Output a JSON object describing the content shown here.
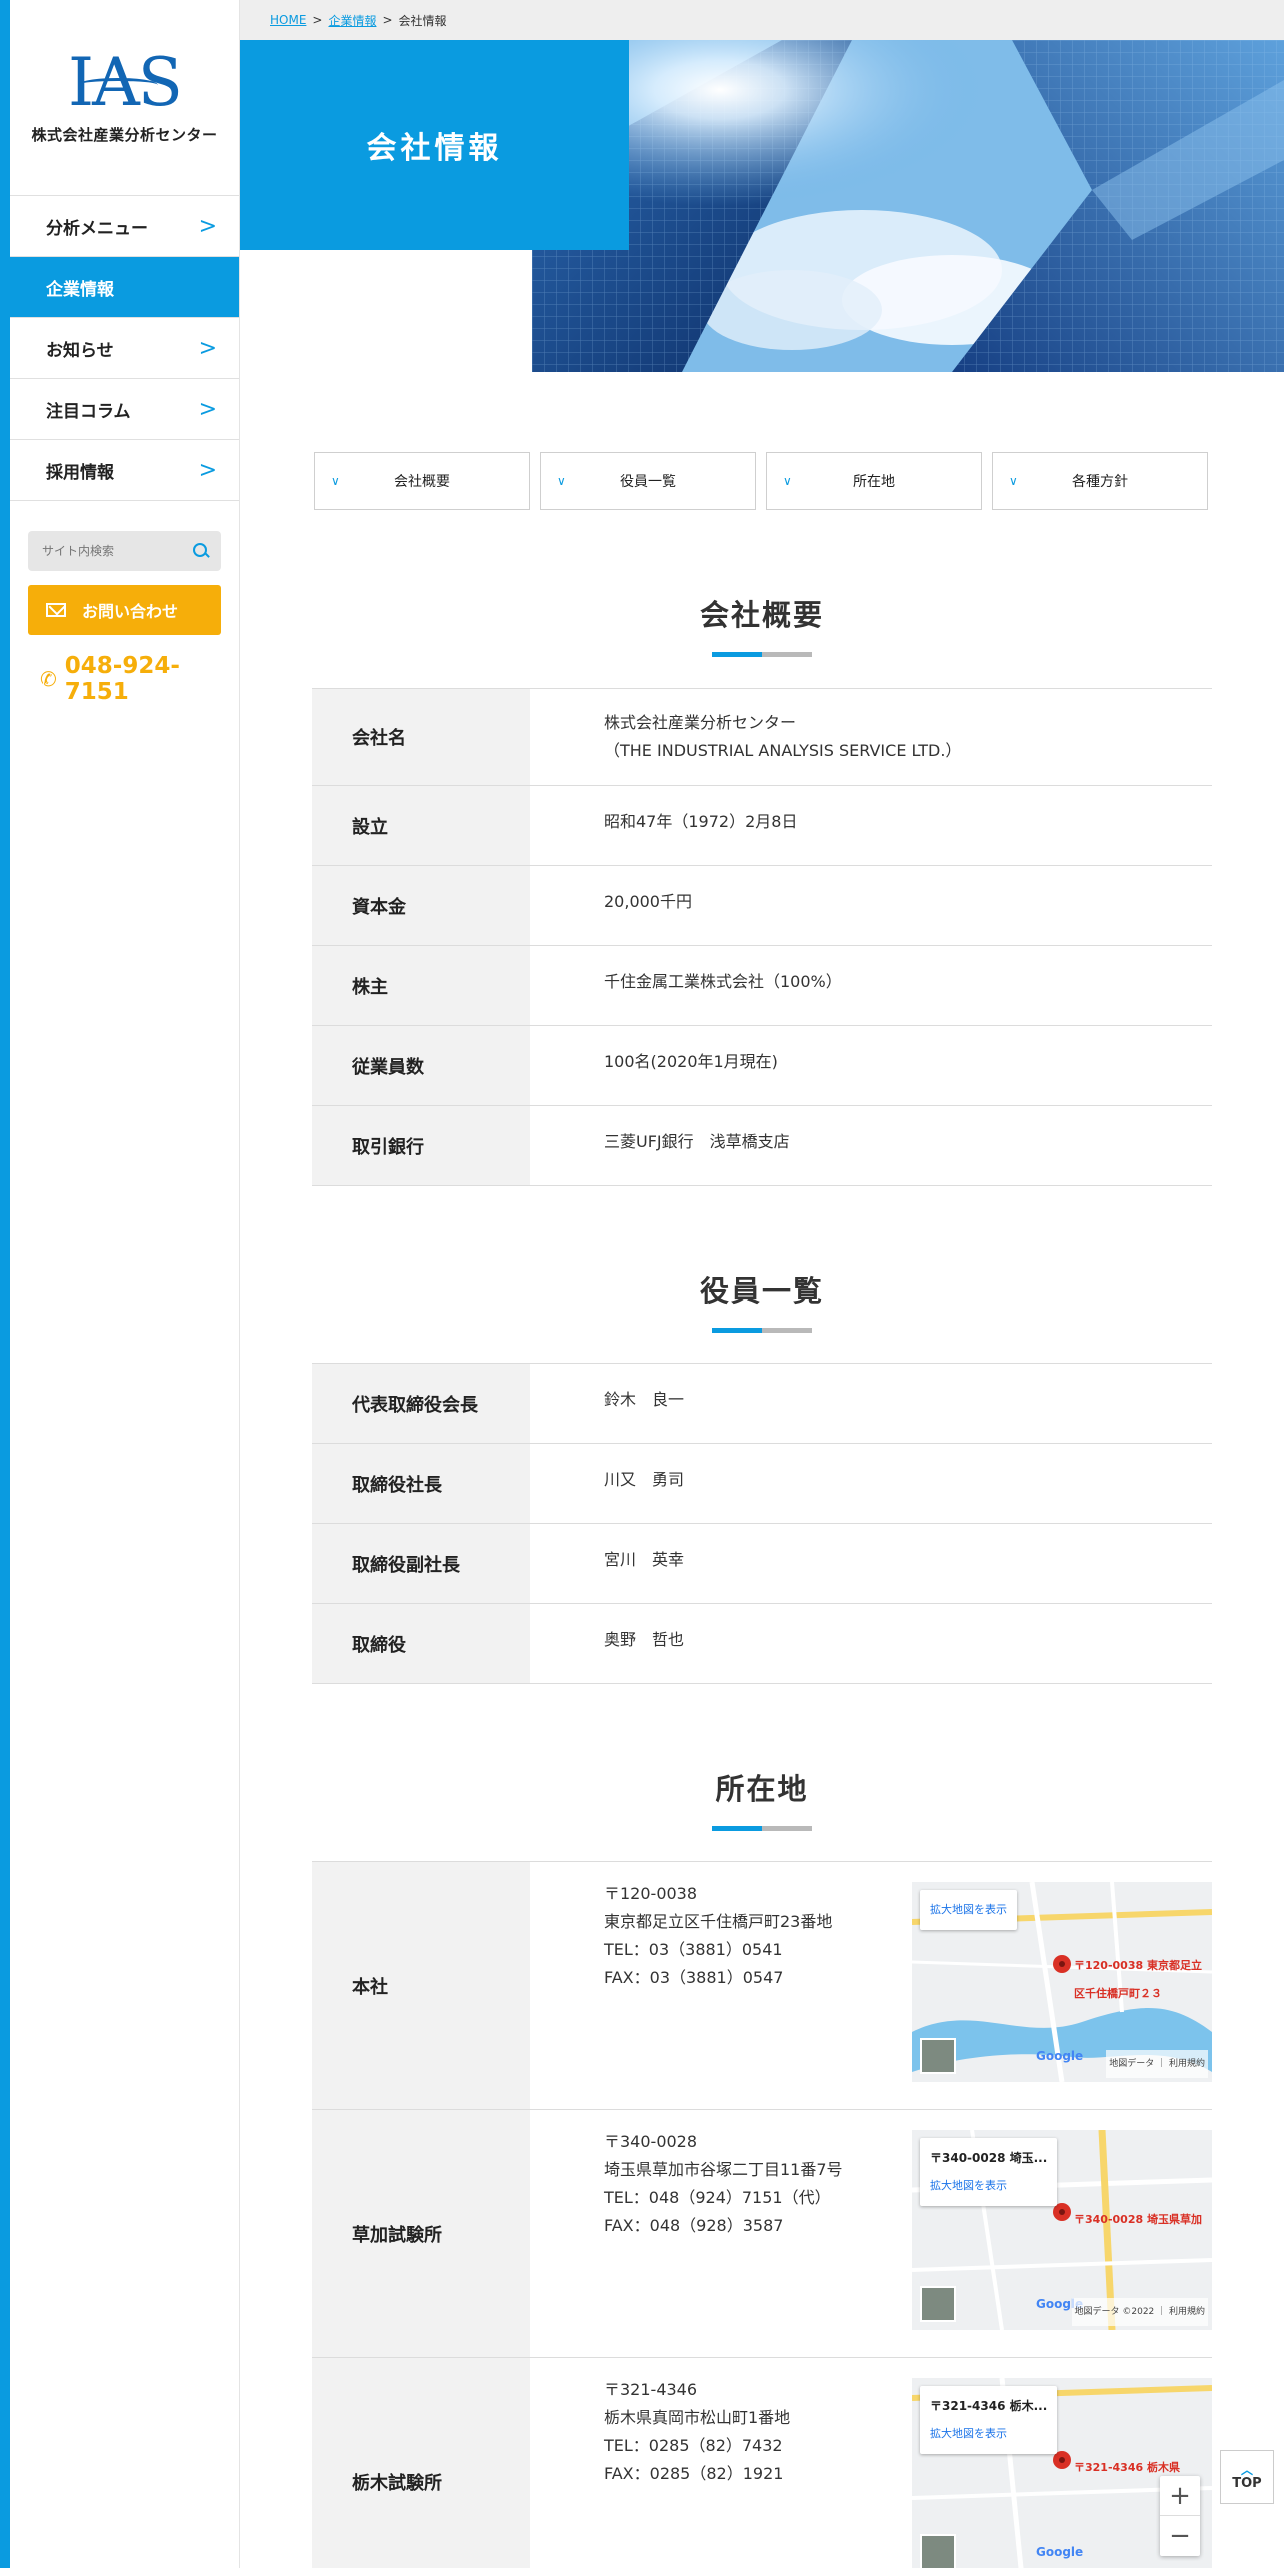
{
  "logo": {
    "mark": "IAS",
    "company": "株式会社産業分析センター"
  },
  "nav": [
    {
      "label": "分析メニュー",
      "active": false
    },
    {
      "label": "企業情報",
      "active": true
    },
    {
      "label": "お知らせ",
      "active": false
    },
    {
      "label": "注目コラム",
      "active": false
    },
    {
      "label": "採用情報",
      "active": false
    }
  ],
  "search": {
    "placeholder": "サイト内検索"
  },
  "contact": {
    "label": "お問い合わせ"
  },
  "phone": "048-924-7151",
  "breadcrumb": {
    "home": "HOME",
    "company": "企業情報",
    "current": "会社情報",
    "sep": ">"
  },
  "hero": {
    "title": "会社情報"
  },
  "tabs": [
    "会社概要",
    "役員一覧",
    "所在地",
    "各種方針"
  ],
  "overview": {
    "title": "会社概要",
    "rows": [
      {
        "label": "会社名",
        "value": "株式会社産業分析センター",
        "value2": "（THE INDUSTRIAL ANALYSIS SERVICE LTD.）"
      },
      {
        "label": "設立",
        "value": "昭和47年（1972）2月8日"
      },
      {
        "label": "資本金",
        "value": "20,000千円"
      },
      {
        "label": "株主",
        "value": "千住金属工業株式会社（100%）"
      },
      {
        "label": "従業員数",
        "value": "100名(2020年1月現在)"
      },
      {
        "label": "取引銀行",
        "value": "三菱UFJ銀行　浅草橋支店"
      }
    ]
  },
  "officers": {
    "title": "役員一覧",
    "rows": [
      {
        "label": "代表取締役会長",
        "value": "鈴木　良一"
      },
      {
        "label": "取締役社長",
        "value": "川又　勇司"
      },
      {
        "label": "取締役副社長",
        "value": "宮川　英幸"
      },
      {
        "label": "取締役",
        "value": "奥野　哲也"
      }
    ]
  },
  "locations": {
    "title": "所在地",
    "rows": [
      {
        "label": "本社",
        "zip": "〒120-0038",
        "address": "東京都足立区千住橋戸町23番地",
        "tel": "TEL：03（3881）0541",
        "fax": "FAX：03（3881）0547",
        "map_card_link": "拡大地図を表示",
        "map_pin": "〒120-0038 東京都足立区千住橋戸町２３",
        "map_foot": "地図データ ｜ 利用規約"
      },
      {
        "label": "草加試験所",
        "zip": "〒340-0028",
        "address": "埼玉県草加市谷塚二丁目11番7号",
        "tel": "TEL：048（924）7151（代）",
        "fax": "FAX：048（928）3587",
        "map_card_addr": "〒340-0028 埼玉...",
        "map_card_link": "拡大地図を表示",
        "map_pin": "〒340-0028 埼玉県草加",
        "map_foot": "地図データ ©2022 ｜ 利用規約"
      },
      {
        "label": "栃木試験所",
        "zip": "〒321-4346",
        "address": "栃木県真岡市松山町1番地",
        "tel": "TEL：0285（82）7432",
        "fax": "FAX：0285（82）1921",
        "map_card_addr": "〒321-4346 栃木...",
        "map_card_link": "拡大地図を表示",
        "map_pin": "〒321-4346 栃木県"
      }
    ]
  },
  "map_brand": "Google",
  "top_button": "TOP",
  "colors": {
    "accent": "#0a9be0",
    "contact": "#f6ae0a",
    "th_bg": "#f2f2f2"
  }
}
